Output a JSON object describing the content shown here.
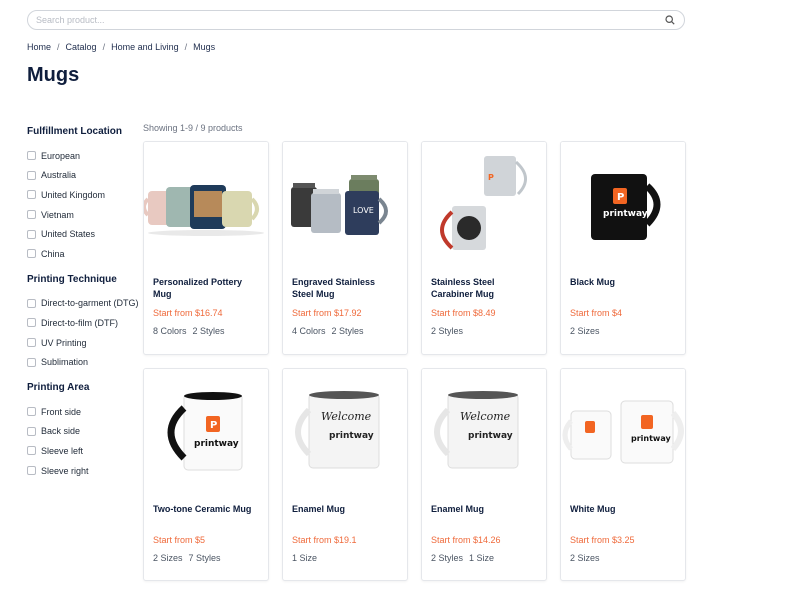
{
  "search": {
    "placeholder": "Search product..."
  },
  "breadcrumb": [
    "Home",
    "Catalog",
    "Home and Living",
    "Mugs"
  ],
  "page_title": "Mugs",
  "showing": "Showing 1-9 / 9 products",
  "filters": [
    {
      "title": "Fulfillment Location",
      "options": [
        "European",
        "Australia",
        "United Kingdom",
        "Vietnam",
        "United States",
        "China"
      ]
    },
    {
      "title": "Printing Technique",
      "options": [
        "Direct-to-garment (DTG)",
        "Direct-to-film (DTF)",
        "UV Printing",
        "Sublimation"
      ]
    },
    {
      "title": "Printing Area",
      "options": [
        "Front side",
        "Back side",
        "Sleeve left",
        "Sleeve right"
      ]
    }
  ],
  "products": [
    {
      "name": "Personalized Pottery Mug",
      "price": "Start from $16.74",
      "meta": [
        "8 Colors",
        "2 Styles"
      ]
    },
    {
      "name": "Engraved Stainless Steel Mug",
      "price": "Start from $17.92",
      "meta": [
        "4 Colors",
        "2 Styles"
      ]
    },
    {
      "name": "Stainless Steel Carabiner Mug",
      "price": "Start from $8.49",
      "meta": [
        "2 Styles"
      ]
    },
    {
      "name": "Black Mug",
      "price": "Start from $4",
      "meta": [
        "2 Sizes"
      ]
    },
    {
      "name": "Two-tone Ceramic Mug",
      "price": "Start from $5",
      "meta": [
        "2 Sizes",
        "7 Styles"
      ]
    },
    {
      "name": "Enamel Mug",
      "price": "Start from $19.1",
      "meta": [
        "1 Size"
      ]
    },
    {
      "name": "Enamel Mug",
      "price": "Start from $14.26",
      "meta": [
        "2 Styles",
        "1 Size"
      ]
    },
    {
      "name": "White Mug",
      "price": "Start from $3.25",
      "meta": [
        "2 Sizes"
      ]
    }
  ],
  "mug_images": [
    "pottery-mugs",
    "stainless-steel-mugs",
    "carabiner-mugs",
    "black-mug",
    "two-tone-mug",
    "enamel-mug",
    "enamel-mug",
    "white-mugs"
  ],
  "colors": {
    "accent": "#ef6a3b",
    "title": "#0f1e3d",
    "brand_orange": "#f26522"
  }
}
